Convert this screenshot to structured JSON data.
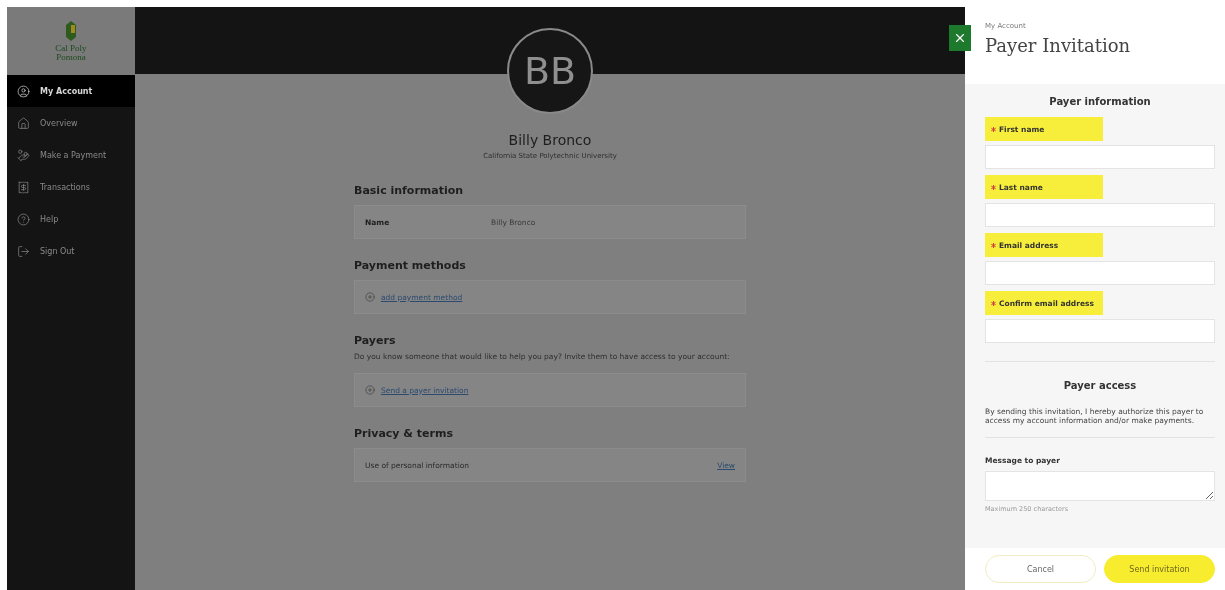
{
  "logo": {
    "text": "Cal Poly Pomona"
  },
  "sidebar": {
    "items": [
      {
        "label": "My Account",
        "selected": true
      },
      {
        "label": "Overview",
        "selected": false
      },
      {
        "label": "Make a Payment",
        "selected": false
      },
      {
        "label": "Transactions",
        "selected": false
      },
      {
        "label": "Help",
        "selected": false
      },
      {
        "label": "Sign Out",
        "selected": false
      }
    ]
  },
  "profile": {
    "initials": "BB",
    "name": "Billy Bronco",
    "school": "California State Polytechnic University"
  },
  "sections": [
    {
      "title": "Basic information",
      "rows": [
        {
          "kind": "field",
          "label": "Name",
          "value": "Billy Bronco"
        }
      ]
    },
    {
      "title": "Payment methods",
      "rows": [
        {
          "kind": "action",
          "link": "add payment method"
        }
      ]
    },
    {
      "title": "Payers",
      "description": "Do you know someone that would like to help you pay? Invite them to have access to your account:",
      "rows": [
        {
          "kind": "action",
          "link": "Send a payer invitation"
        }
      ]
    },
    {
      "title": "Privacy & terms",
      "rows": [
        {
          "kind": "link-row",
          "label": "Use of personal information",
          "link": "View"
        }
      ]
    }
  ],
  "panel": {
    "breadcrumb": "My Account",
    "title": "Payer Invitation",
    "info_heading": "Payer information",
    "fields": [
      {
        "label": "First name",
        "required": true,
        "highlighted": true
      },
      {
        "label": "Last name",
        "required": true,
        "highlighted": true
      },
      {
        "label": "Email address",
        "required": true,
        "highlighted": true
      },
      {
        "label": "Confirm email address",
        "required": true,
        "highlighted": true
      }
    ],
    "access_heading": "Payer access",
    "access_text": "By sending this invitation, I hereby authorize this payer to access my account information and/or make payments.",
    "message_label": "Message to payer",
    "message_hint": "Maximum 250 characters",
    "buttons": [
      {
        "label": "Cancel",
        "kind": "secondary",
        "highlighted": false
      },
      {
        "label": "Send invitation",
        "kind": "primary",
        "highlighted": true
      }
    ]
  }
}
